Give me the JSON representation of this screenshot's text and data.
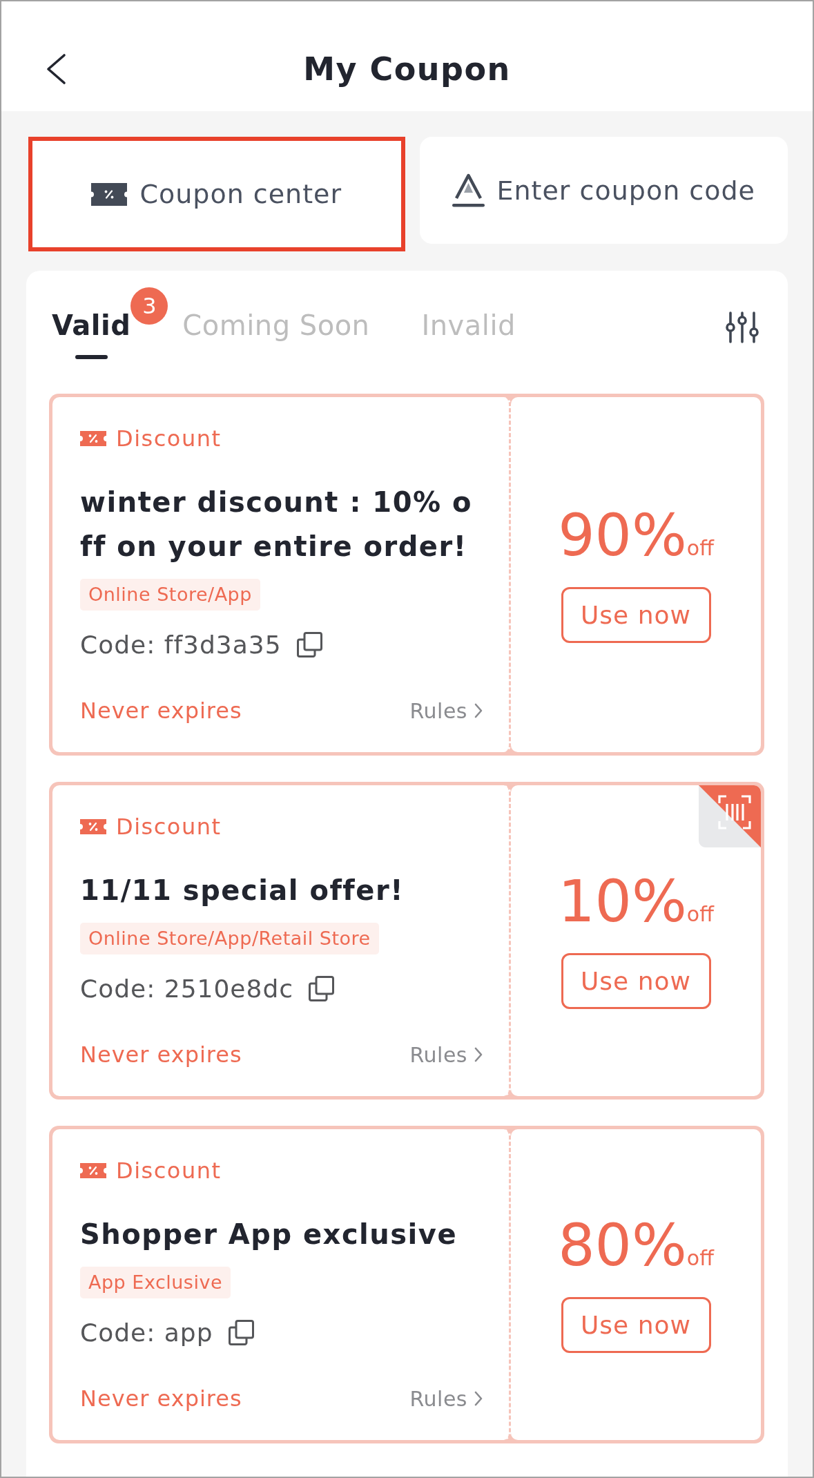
{
  "header": {
    "title": "My Coupon"
  },
  "actions": [
    {
      "kind": "center",
      "label": "Coupon center",
      "highlighted": true
    },
    {
      "kind": "code",
      "label": "Enter coupon code",
      "highlighted": false
    }
  ],
  "tabs": [
    {
      "label": "Valid",
      "selected": true,
      "badge": "3"
    },
    {
      "label": "Coming Soon",
      "selected": false
    },
    {
      "label": "Invalid",
      "selected": false
    }
  ],
  "coupons": [
    {
      "type_label": "Discount",
      "title": "winter discount : 10% off on your entire order!",
      "channel": "Online Store/App",
      "code": "Code: ff3d3a35",
      "expiry": "Never expires",
      "rules": "Rules",
      "amount": "90%",
      "unit": "off",
      "button": "Use now",
      "scan_badge": false
    },
    {
      "type_label": "Discount",
      "title": "11/11 special offer!",
      "channel": "Online Store/App/Retail Store",
      "code": "Code: 2510e8dc",
      "expiry": "Never expires",
      "rules": "Rules",
      "amount": "10%",
      "unit": "off",
      "button": "Use now",
      "scan_badge": true
    },
    {
      "type_label": "Discount",
      "title": "Shopper App exclusive",
      "channel": "App Exclusive",
      "code": "Code: app",
      "expiry": "Never expires",
      "rules": "Rules",
      "amount": "80%",
      "unit": "off",
      "button": "Use now",
      "scan_badge": false
    }
  ]
}
